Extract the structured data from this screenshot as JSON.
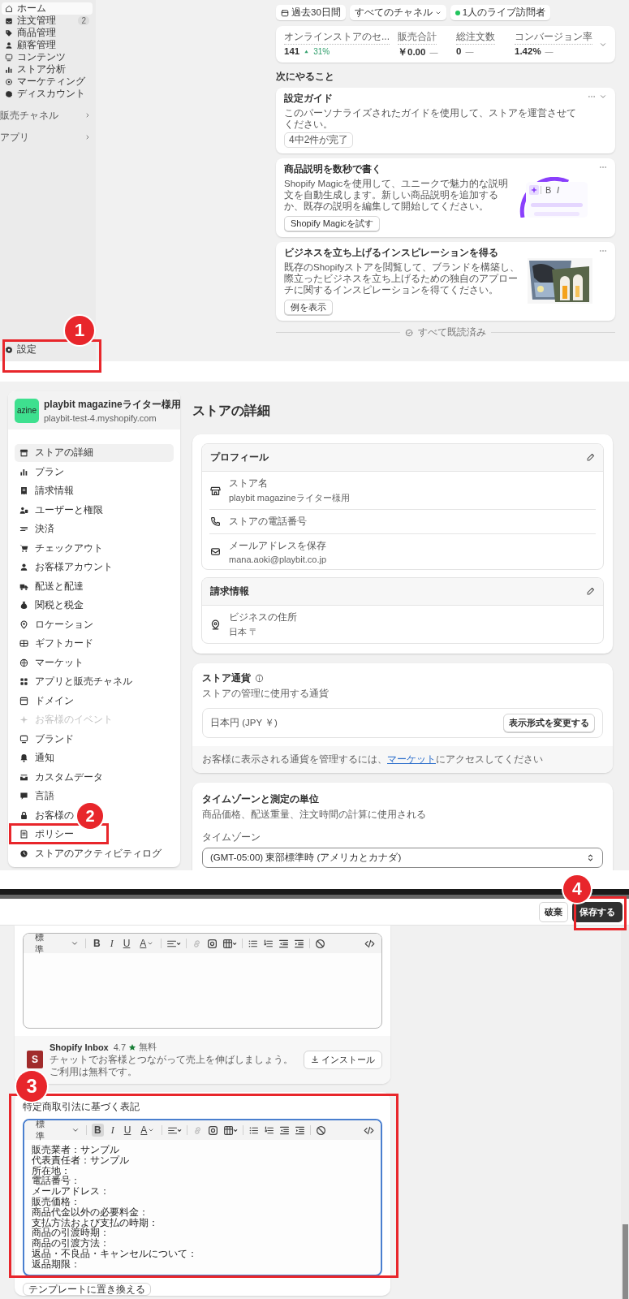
{
  "home": {
    "sidebar": {
      "items": [
        {
          "label": "ホーム",
          "selected": true
        },
        {
          "label": "注文管理",
          "selected": false,
          "badge": "2"
        },
        {
          "label": "商品管理",
          "selected": false
        },
        {
          "label": "顧客管理",
          "selected": false
        },
        {
          "label": "コンテンツ",
          "selected": false
        },
        {
          "label": "ストア分析",
          "selected": false
        },
        {
          "label": "マーケティング",
          "selected": false
        },
        {
          "label": "ディスカウント",
          "selected": false
        }
      ],
      "groups": [
        "販売チャネル",
        "アプリ"
      ],
      "settings": "設定"
    },
    "filters": [
      {
        "kind": "date",
        "label": "過去30日間"
      },
      {
        "kind": "dropdown",
        "label": "すべてのチャネル"
      },
      {
        "kind": "live",
        "label": "1人のライブ訪問者"
      }
    ],
    "metrics": [
      {
        "label": "オンラインストアのセ...",
        "value": "141",
        "change": "31%",
        "kind": "increase"
      },
      {
        "label": "販売合計",
        "value": "￥0.00",
        "change": "—",
        "kind": "unchanged"
      },
      {
        "label": "総注文数",
        "value": "0",
        "change": "—",
        "kind": "unchanged"
      },
      {
        "label": "コンバージョン率",
        "value": "1.42%",
        "change": "—",
        "kind": "unchanged"
      }
    ],
    "next_heading": "次にやること",
    "tasks": [
      {
        "kind": "guide",
        "title": "設定ガイド",
        "description": "このパーソナライズされたガイドを使用して、ストアを運営させてください。",
        "badge": "4中2件が完了"
      },
      {
        "kind": "magic",
        "title": "商品説明を数秒で書く",
        "description": "Shopify Magicを使用して、ユニークで魅力的な説明文を自動生成します。新しい商品説明を追加するか、既存の説明を編集して開始してください。",
        "button": "Shopify Magicを試す",
        "illustration_labels": [
          "B",
          "I"
        ]
      },
      {
        "kind": "inspiration",
        "title": "ビジネスを立ち上げるインスピレーションを得る",
        "description": "既存のShopifyストアを閲覧して、ブランドを構築し、際立ったビジネスを立ち上げるための独自のアプローチに関するインスピレーションを得てください。",
        "button": "例を表示"
      }
    ],
    "all_read": "すべて既読済み"
  },
  "settings": {
    "store": {
      "logo_text": "azine",
      "name": "playbit magazineライター様用",
      "domain": "playbit-test-4.myshopify.com"
    },
    "nav": [
      {
        "label": "ストアの詳細",
        "selected": true,
        "disabled": false
      },
      {
        "label": "プラン",
        "selected": false,
        "disabled": false
      },
      {
        "label": "請求情報",
        "selected": false,
        "disabled": false
      },
      {
        "label": "ユーザーと権限",
        "selected": false,
        "disabled": false
      },
      {
        "label": "決済",
        "selected": false,
        "disabled": false
      },
      {
        "label": "チェックアウト",
        "selected": false,
        "disabled": false
      },
      {
        "label": "お客様アカウント",
        "selected": false,
        "disabled": false
      },
      {
        "label": "配送と配達",
        "selected": false,
        "disabled": false
      },
      {
        "label": "関税と税金",
        "selected": false,
        "disabled": false
      },
      {
        "label": "ロケーション",
        "selected": false,
        "disabled": false
      },
      {
        "label": "ギフトカード",
        "selected": false,
        "disabled": false
      },
      {
        "label": "マーケット",
        "selected": false,
        "disabled": false
      },
      {
        "label": "アプリと販売チャネル",
        "selected": false,
        "disabled": false
      },
      {
        "label": "ドメイン",
        "selected": false,
        "disabled": false
      },
      {
        "label": "お客様のイベント",
        "selected": false,
        "disabled": true
      },
      {
        "label": "ブランド",
        "selected": false,
        "disabled": false
      },
      {
        "label": "通知",
        "selected": false,
        "disabled": false
      },
      {
        "label": "カスタムデータ",
        "selected": false,
        "disabled": false
      },
      {
        "label": "言語",
        "selected": false,
        "disabled": false
      },
      {
        "label": "お客様の",
        "selected": false,
        "disabled": false
      },
      {
        "label": "ポリシー",
        "selected": false,
        "disabled": false
      },
      {
        "label": "ストアのアクティビティログ",
        "selected": false,
        "disabled": false
      }
    ],
    "title": "ストアの詳細",
    "profile": {
      "heading": "プロフィール",
      "rows": [
        {
          "kind": "store",
          "label": "ストア名",
          "value": "playbit magazineライター様用"
        },
        {
          "kind": "phone",
          "label": "ストアの電話番号"
        },
        {
          "kind": "email",
          "label": "メールアドレスを保存",
          "value": "mana.aoki@playbit.co.jp"
        }
      ]
    },
    "billing": {
      "heading": "請求情報",
      "rows": [
        {
          "kind": "address",
          "label": "ビジネスの住所",
          "value": "日本 〒"
        }
      ]
    },
    "currency": {
      "title": "ストア通貨",
      "description": "ストアの管理に使用する通貨",
      "value": "日本円 (JPY ￥)",
      "button": "表示形式を変更する",
      "note_before": "お客様に表示される通貨を管理するには、",
      "note_link": "マーケット",
      "note_after": "にアクセスしてください"
    },
    "timezone": {
      "title": "タイムゾーンと測定の単位",
      "description": "商品価格、配送重量、注文時間の計算に使用される",
      "field_label": "タイムゾーン",
      "value": "(GMT-05:00) 東部標準時 (アメリカとカナダ)"
    }
  },
  "policy_editor": {
    "discard": "破棄",
    "save": "保存する",
    "editor": {
      "focused": false,
      "toolbar": {
        "format": "標準",
        "marks": [
          {
            "label": "B",
            "selected": false
          },
          {
            "label": "I",
            "selected": false
          },
          {
            "label": "U",
            "selected": false
          }
        ],
        "font_letter": "A"
      }
    },
    "app": {
      "logo_text": "S",
      "name": "Shopify Inbox",
      "rating": "4.7",
      "price": "無料",
      "description": "チャットでお客様とつながって売上を伸ばしましょう。ご利用は無料です。",
      "button": "インストール"
    },
    "legal": {
      "title": "特定商取引法に基づく表記",
      "focused": true,
      "toolbar": {
        "format": "標準",
        "marks": [
          {
            "label": "B",
            "selected": true
          },
          {
            "label": "I",
            "selected": false
          },
          {
            "label": "U",
            "selected": false
          }
        ],
        "font_letter": "A"
      },
      "lines": [
        "販売業者：サンプル",
        "代表責任者：サンプル",
        "所在地：",
        "電話番号：",
        "メールアドレス：",
        "販売価格：",
        "商品代金以外の必要料金：",
        "支払方法および支払の時期：",
        "商品の引渡時期：",
        "商品の引渡方法：",
        "返品・不良品・キャンセルについて：",
        "返品期限："
      ],
      "replace_button": "テンプレートに置き換える"
    }
  },
  "annotations": [
    {
      "number": "1"
    },
    {
      "number": "2"
    },
    {
      "number": "3"
    },
    {
      "number": "4"
    }
  ]
}
